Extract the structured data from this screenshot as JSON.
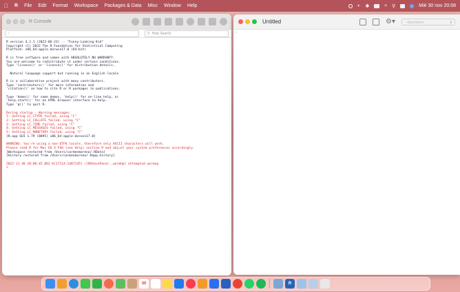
{
  "menubar": {
    "app_name": "R",
    "items": [
      "File",
      "Edit",
      "Format",
      "Workspace",
      "Packages & Data",
      "Misc",
      "Window",
      "Help"
    ],
    "clock": "Mié 30 nov  20:08"
  },
  "console_window": {
    "title": "R Console",
    "path_value": "~",
    "help_search_placeholder": "Help Search",
    "lines": [
      {
        "text": "R version 4.2.1 (2022-06-23) -- \"Funny-Looking Kid\"",
        "color": "normal"
      },
      {
        "text": "Copyright (C) 2022 The R Foundation for Statistical Computing",
        "color": "normal"
      },
      {
        "text": "Platform: x86_64-apple-darwin17.0 (64-bit)",
        "color": "normal"
      },
      {
        "text": "",
        "color": "normal"
      },
      {
        "text": "R is free software and comes with ABSOLUTELY NO WARRANTY.",
        "color": "normal"
      },
      {
        "text": "You are welcome to redistribute it under certain conditions.",
        "color": "normal"
      },
      {
        "text": "Type 'license()' or 'licence()' for distribution details.",
        "color": "normal"
      },
      {
        "text": "",
        "color": "normal"
      },
      {
        "text": "  Natural language support but running in an English locale",
        "color": "normal"
      },
      {
        "text": "",
        "color": "normal"
      },
      {
        "text": "R is a collaborative project with many contributors.",
        "color": "normal"
      },
      {
        "text": "Type 'contributors()' for more information and",
        "color": "normal"
      },
      {
        "text": "'citation()' on how to cite R or R packages in publications.",
        "color": "normal"
      },
      {
        "text": "",
        "color": "normal"
      },
      {
        "text": "Type 'demo()' for some demos, 'help()' for on-line help, or",
        "color": "normal"
      },
      {
        "text": "'help.start()' for an HTML browser interface to help.",
        "color": "normal"
      },
      {
        "text": "Type 'q()' to quit R.",
        "color": "normal"
      },
      {
        "text": "",
        "color": "normal"
      },
      {
        "text": "During startup - Warning messages:",
        "color": "red"
      },
      {
        "text": "1: Setting LC_CTYPE failed, using \"C\"",
        "color": "red"
      },
      {
        "text": "2: Setting LC_COLLATE failed, using \"C\"",
        "color": "red"
      },
      {
        "text": "3: Setting LC_TIME failed, using \"C\"",
        "color": "red"
      },
      {
        "text": "4: Setting LC_MESSAGES failed, using \"C\"",
        "color": "red"
      },
      {
        "text": "5: Setting LC_MONETARY failed, using \"C\"",
        "color": "red"
      },
      {
        "text": "[R.app GUI 1.79 (8095) x86_64-apple-darwin17.0]",
        "color": "normal"
      },
      {
        "text": "",
        "color": "normal"
      },
      {
        "text": "WARNING: You're using a non-UTF8 locale, therefore only ASCII characters will work.",
        "color": "red"
      },
      {
        "text": "Please read R for Mac OS X FAQ (see Help) section 9 and adjust your system preferences accordingly.",
        "color": "red"
      },
      {
        "text": "[Workspace restored from /Users/carmenmoreno/.RData]",
        "color": "normal"
      },
      {
        "text": "[History restored from /Users/carmenmoreno/.Rapp.history]",
        "color": "normal"
      },
      {
        "text": "",
        "color": "normal"
      },
      {
        "text": "2022-11-30 20:08:45.062 R[17114:1487245] +[NSSavePanel _warmUp] attempted warmup",
        "color": "red"
      },
      {
        "text": ">",
        "color": "red"
      }
    ]
  },
  "editor_window": {
    "title": "Untitled",
    "function_select_placeholder": "<functions>",
    "line_marker": "1"
  },
  "colors": {
    "menubar_bg": "#b4545a",
    "console_red": "#d4262a",
    "traffic_red": "#ff5f57",
    "traffic_yellow": "#febc2e",
    "traffic_green": "#28c840"
  },
  "dock": {
    "apps": [
      {
        "name": "finder-icon",
        "color": "#3b8ff0"
      },
      {
        "name": "launchpad-icon",
        "color": "#f0a030"
      },
      {
        "name": "safari-icon",
        "color": "#2f8de0"
      },
      {
        "name": "messages-icon",
        "color": "#3ec84c"
      },
      {
        "name": "facetime-icon",
        "color": "#2fb34a"
      },
      {
        "name": "photos-icon",
        "color": "#f56a4a"
      },
      {
        "name": "maps-icon",
        "color": "#5fbf5f"
      },
      {
        "name": "contacts-icon",
        "color": "#c9a27a"
      },
      {
        "name": "calendar-icon",
        "color": "#ffffff",
        "label": "30"
      },
      {
        "name": "reminders-icon",
        "color": "#ffffff"
      },
      {
        "name": "notes-icon",
        "color": "#ffd84a"
      },
      {
        "name": "app-store-icon",
        "color": "#1f7cf0"
      },
      {
        "name": "music-icon",
        "color": "#fa3a55"
      },
      {
        "name": "pages-icon",
        "color": "#f39a2a"
      },
      {
        "name": "keynote-icon",
        "color": "#2a6ff0"
      },
      {
        "name": "word-icon",
        "color": "#2b5fbf"
      },
      {
        "name": "chrome-icon",
        "color": "#ea4335"
      },
      {
        "name": "whatsapp-icon",
        "color": "#25d366"
      },
      {
        "name": "spotify-icon",
        "color": "#1db954"
      },
      {
        "name": "preview-icon",
        "color": "#7aa7d8"
      },
      {
        "name": "r-app-icon",
        "color": "#2266b8",
        "label": "R"
      },
      {
        "name": "downloads-icon",
        "color": "#9fc2e8"
      },
      {
        "name": "documents-icon",
        "color": "#b9cfe8"
      },
      {
        "name": "trash-icon",
        "color": "#e8e8e8"
      }
    ]
  }
}
